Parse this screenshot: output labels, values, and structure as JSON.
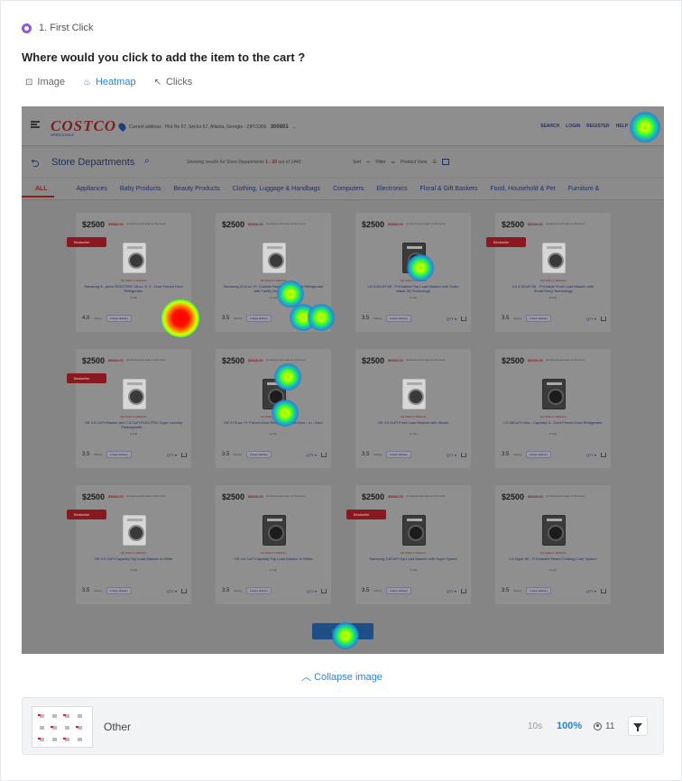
{
  "header": {
    "step": "1. First Click",
    "question": "Where would you click to add the item to the cart ?"
  },
  "tabs": [
    {
      "label": "Image",
      "icon": "image-icon"
    },
    {
      "label": "Heatmap",
      "icon": "flame-icon",
      "active": true
    },
    {
      "label": "Clicks",
      "icon": "cursor-icon"
    }
  ],
  "screenshot": {
    "logo": "COSTCO",
    "logo_sub": "WHOLESALE",
    "location_label": "Current address",
    "location_text": "Plot No 67, Sector 67, Atlanta, Georgia - ZIPCODE",
    "location_zip": "300801",
    "top_nav": [
      "SEARCH",
      "LOGIN",
      "REGISTER",
      "HELP"
    ],
    "dept_title": "Store Departments",
    "results_prefix": "Showing results for Store Departments",
    "results_range": "1 - 20",
    "results_suffix": "out of 1440",
    "sort_label": "Sort",
    "filter_label": "Filter",
    "view_label": "Product View",
    "categories": [
      "ALL",
      "Appliances",
      "Baby Products",
      "Beauty Products",
      "Clothing, Luggage & Handbags",
      "Computers",
      "Electronics",
      "Floral & Gift Baskets",
      "Food, Household & Pet",
      "Furniture &"
    ],
    "products": [
      {
        "price": "$2500",
        "strike": "$5000.00",
        "name": "Samsung 4 - piece ELECTRIC 28 cu. ft. 3 - Door French Door Refrigerator",
        "rating": "4.0",
        "bestseller": true,
        "dark": false
      },
      {
        "price": "$2500",
        "strike": "$5000.00",
        "name": "Samsung 22.6 cu. Ft. Counter Depth French Door Refrigerator with Family Hub in Black",
        "rating": "3.5",
        "bestseller": false,
        "dark": false
      },
      {
        "price": "$2500",
        "strike": "$5000.00",
        "name": "LG 5.5CuFt Wi - Fi Enabled Top Load Washer with Turbo Wash 3D Technology",
        "rating": "3.5",
        "bestseller": false,
        "dark": true
      },
      {
        "price": "$2500",
        "strike": "$5000.00",
        "name": "LG 4.5CuFt Wi - Fi Enable Front Load Washer with SmartThinQ Technology",
        "rating": "3.5",
        "bestseller": true,
        "dark": false
      },
      {
        "price": "$2500",
        "strike": "$5000.00",
        "name": "GE 4.5 CuFt Washer and 7.5 CuFt ELECTRIC Dryer Laundry Packagewith ...",
        "rating": "3.5",
        "bestseller": true,
        "dark": false
      },
      {
        "price": "$2500",
        "strike": "$5000.00",
        "name": "GE 27.8 cu. Ft. French Door Refrigerator with Door - In - Door",
        "rating": "3.5",
        "bestseller": false,
        "dark": true
      },
      {
        "price": "$2500",
        "strike": "$5000.00",
        "name": "GE 4.5 CuFt Front Load Washer with Steam",
        "rating": "3.5",
        "bestseller": false,
        "dark": false
      },
      {
        "price": "$2500",
        "strike": "$5000.00",
        "name": "LG 28CuFt Ultra - Capacity 4 - Door French Door Refrigerator",
        "rating": "3.5",
        "bestseller": false,
        "dark": true
      },
      {
        "price": "$2500",
        "strike": "$5000.00",
        "name": "GE 4.2 CuFt Capacity Top Load Washer in White",
        "rating": "3.5",
        "bestseller": true,
        "dark": false
      },
      {
        "price": "$2500",
        "strike": "$5000.00",
        "name": "GE 4.6 CuFt Capacity Top Load Washer in White",
        "rating": "3.5",
        "bestseller": false,
        "dark": true
      },
      {
        "price": "$2500",
        "strike": "$5000.00",
        "name": "Samsung 3.8CuFt Top Load Washer with Super Speed",
        "rating": "3.5",
        "bestseller": true,
        "dark": true
      },
      {
        "price": "$2500",
        "strike": "$5000.00",
        "name": "LG Dryer Wi - Fi Enabled Steam Clothing Care System",
        "rating": "3.5",
        "bestseller": false,
        "dark": true
      }
    ],
    "product_fine": "(Limited period sale on this item)",
    "product_tag": "Top Seller in Washers",
    "stock_text": "(1 left)",
    "rating_suffix": "Rating",
    "badge_text": "Bestseller",
    "delivery_text": "2 days delivery",
    "qty_label": "QTY",
    "load_more": "Load More"
  },
  "collapse_label": "Collapse image",
  "result": {
    "label": "Other",
    "time": "10s",
    "percent": "100%",
    "users": "11"
  }
}
